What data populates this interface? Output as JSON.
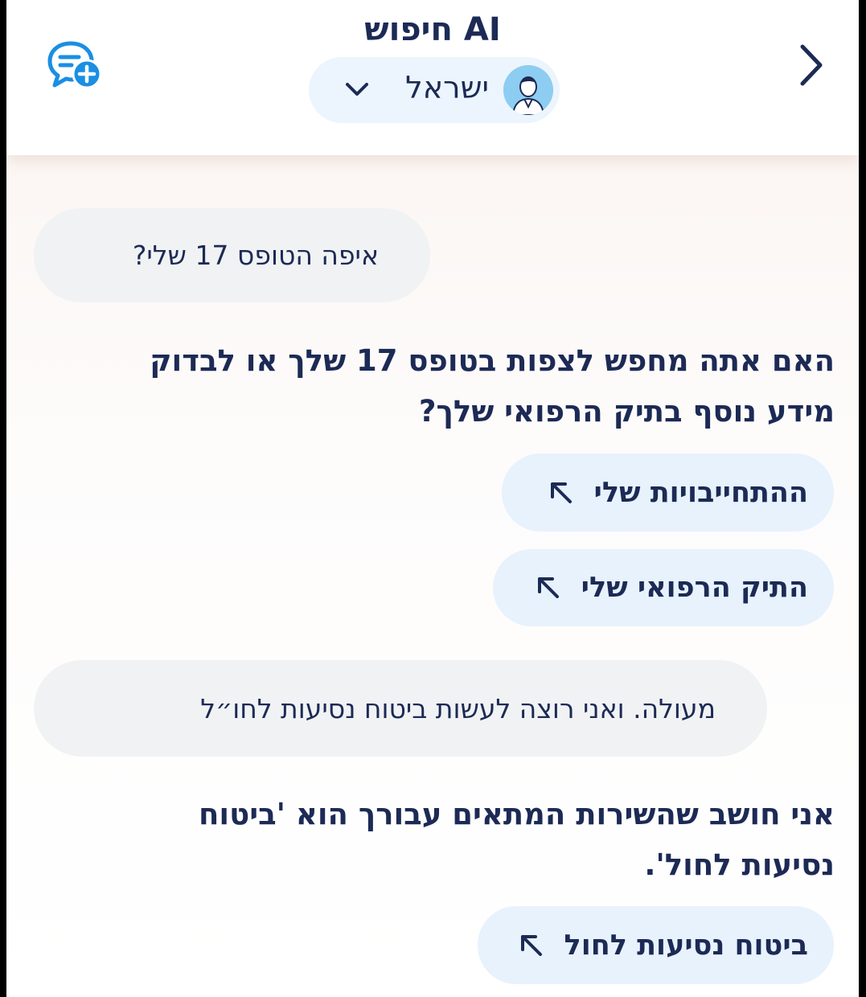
{
  "header": {
    "title": "חיפוש AI",
    "profile_name": "ישראל"
  },
  "icons": {
    "new_chat": "chat-plus-icon",
    "back": "chevron-right-icon",
    "dropdown": "chevron-down-icon",
    "avatar": "user-avatar-icon",
    "action_arrow": "arrow-up-left-icon"
  },
  "colors": {
    "text": "#1c2a55",
    "accent": "#1a8fe3",
    "user_bubble": "#f1f2f4",
    "action_bubble": "#e7f2fc"
  },
  "conversation": [
    {
      "role": "user",
      "text": "איפה הטופס 17 שלי?"
    },
    {
      "role": "assistant",
      "lines": [
        "האם אתה מחפש לצפות בטופס 17 שלך או לבדוק",
        "מידע נוסף בתיק הרפואי שלך?"
      ]
    },
    {
      "role": "action",
      "label": "ההתחייבויות שלי"
    },
    {
      "role": "action",
      "label": "התיק הרפואי שלי"
    },
    {
      "role": "user",
      "text": "מעולה. ואני רוצה לעשות ביטוח נסיעות לחו״ל"
    },
    {
      "role": "assistant",
      "lines": [
        "אני חושב שהשירות המתאים עבורך הוא 'ביטוח",
        "נסיעות לחול'."
      ]
    },
    {
      "role": "action",
      "label": "ביטוח נסיעות לחול"
    }
  ]
}
